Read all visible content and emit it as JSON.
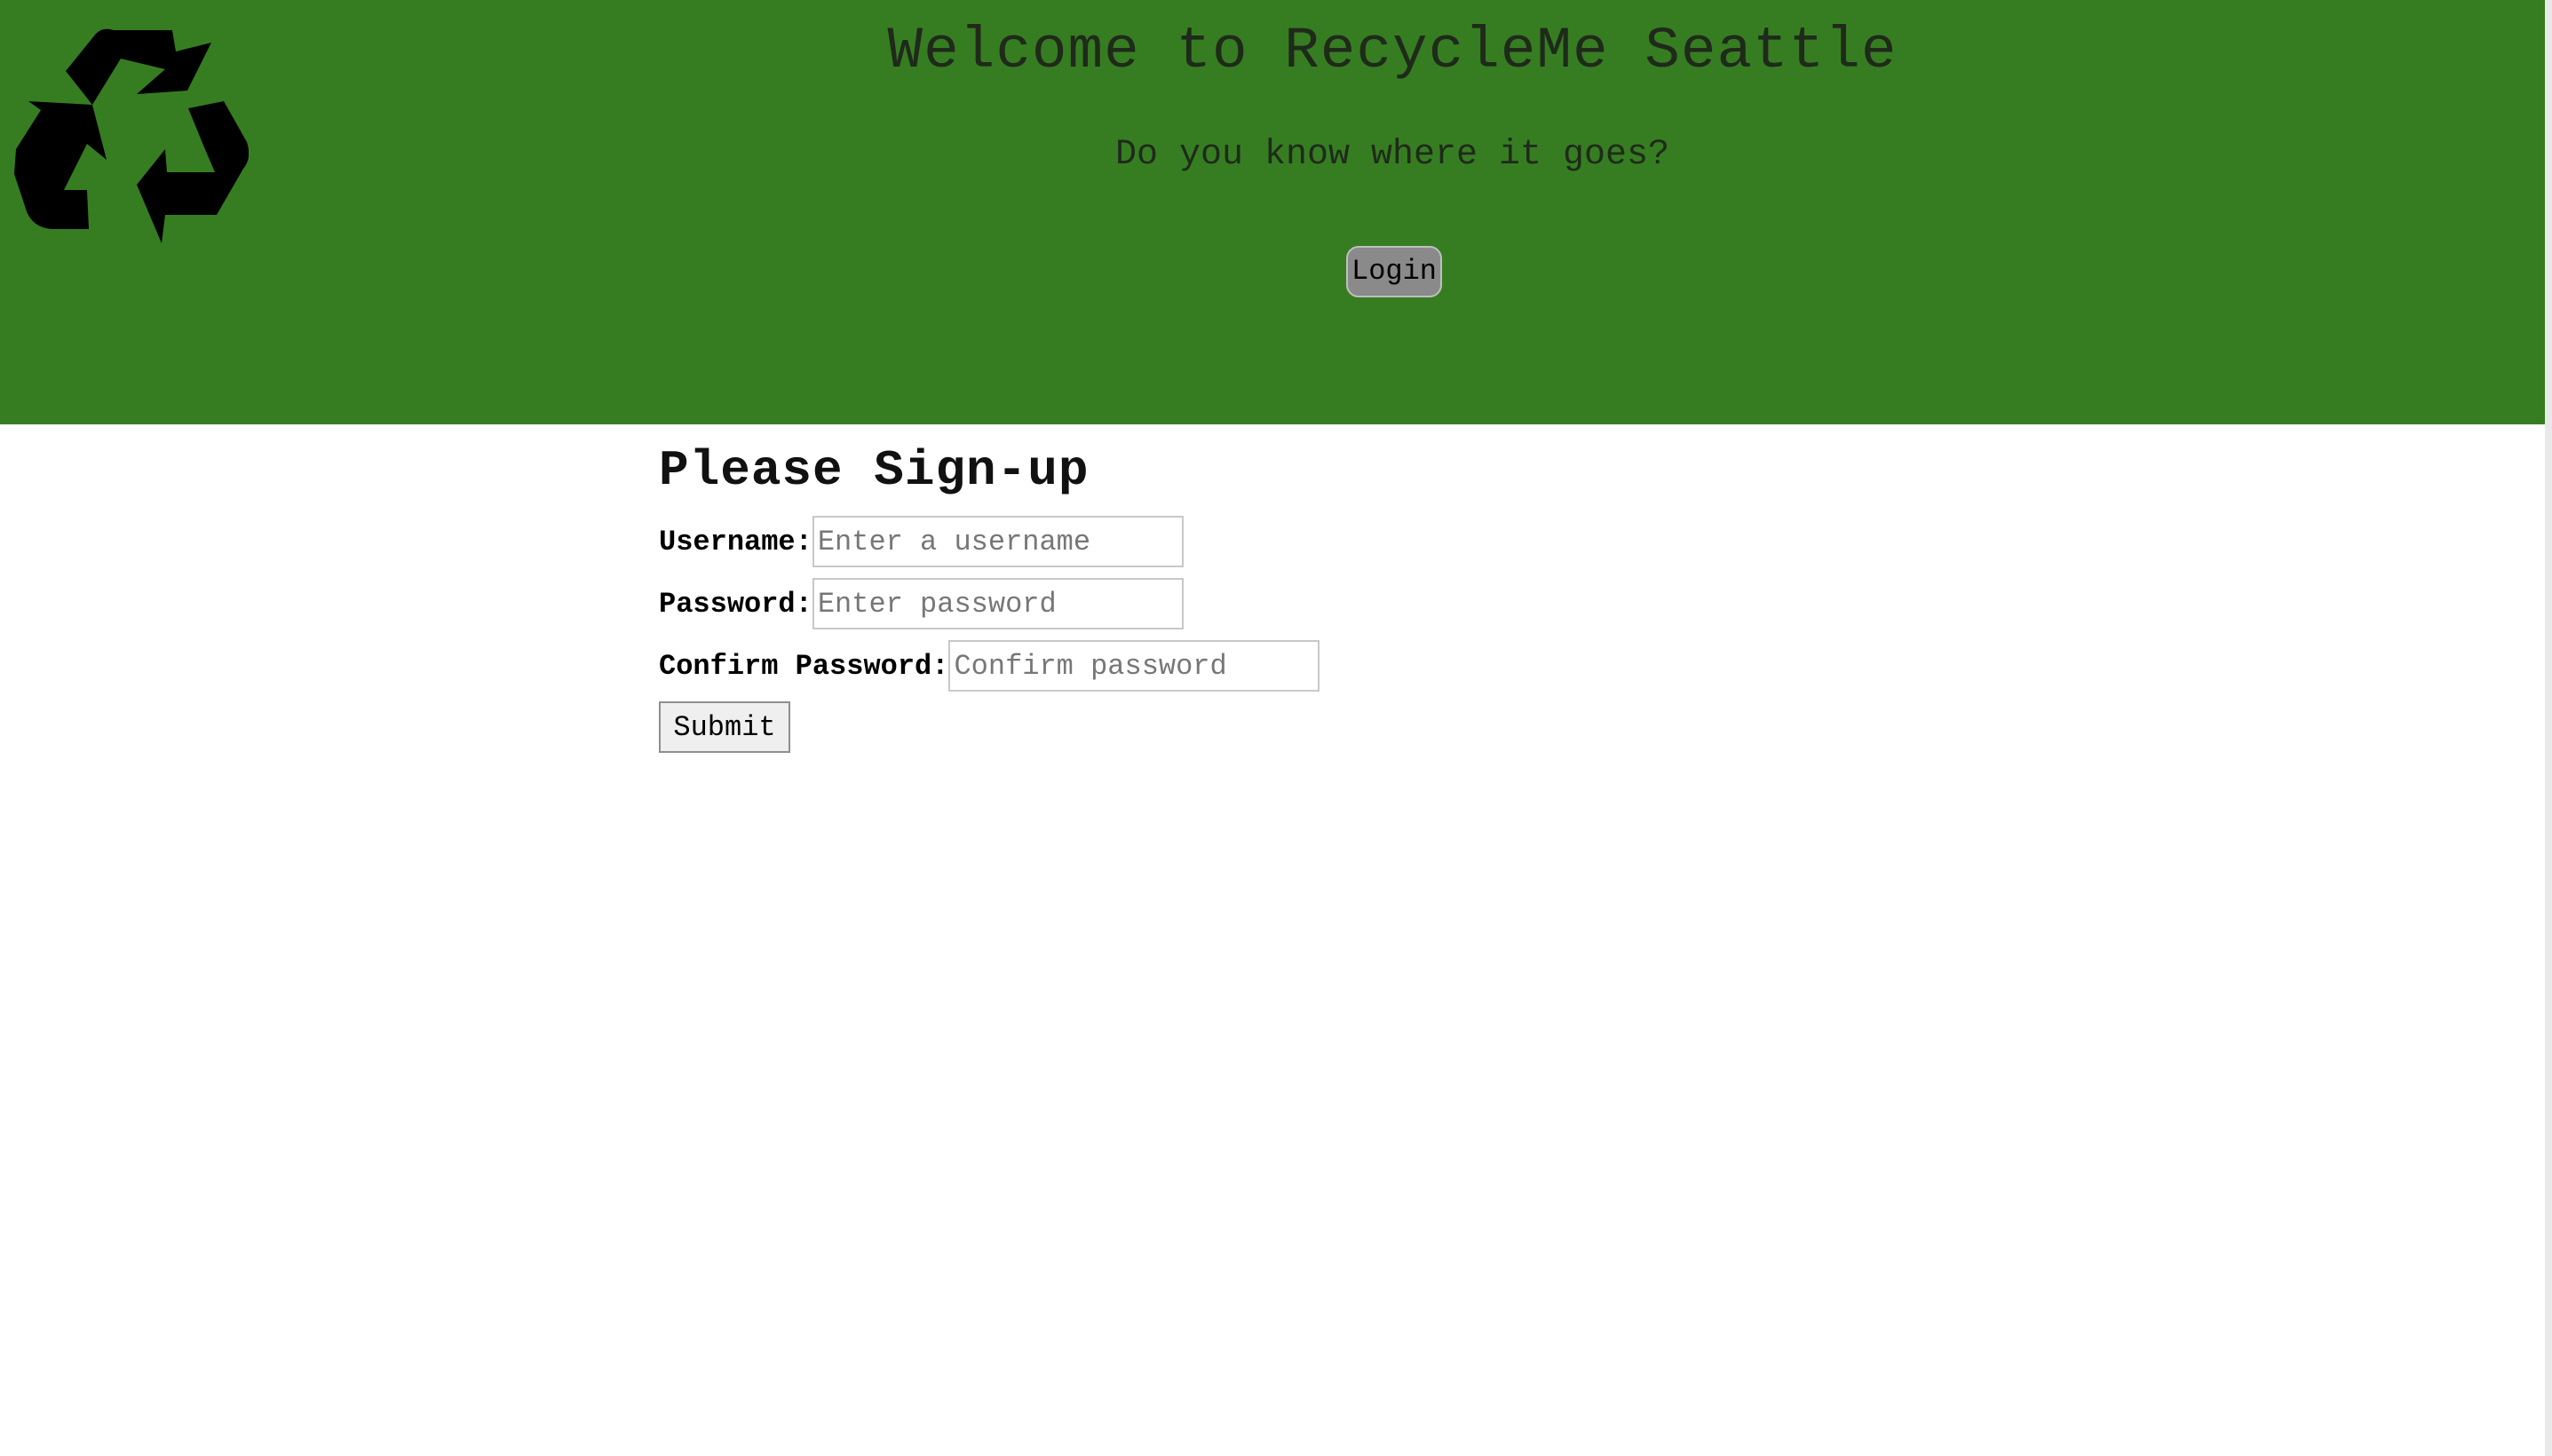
{
  "header": {
    "title": "Welcome to RecycleMe Seattle",
    "tagline": "Do you know where it goes?",
    "login_label": "Login",
    "logo_icon": "recycle-icon",
    "background_color": "#367d22"
  },
  "signup": {
    "title": "Please Sign-up",
    "username_label": "Username:",
    "username_placeholder": "Enter a username",
    "username_value": "",
    "password_label": "Password:",
    "password_placeholder": "Enter password",
    "password_value": "",
    "confirm_label": "Confirm Password:",
    "confirm_placeholder": "Confirm password",
    "confirm_value": "",
    "submit_label": "Submit"
  }
}
